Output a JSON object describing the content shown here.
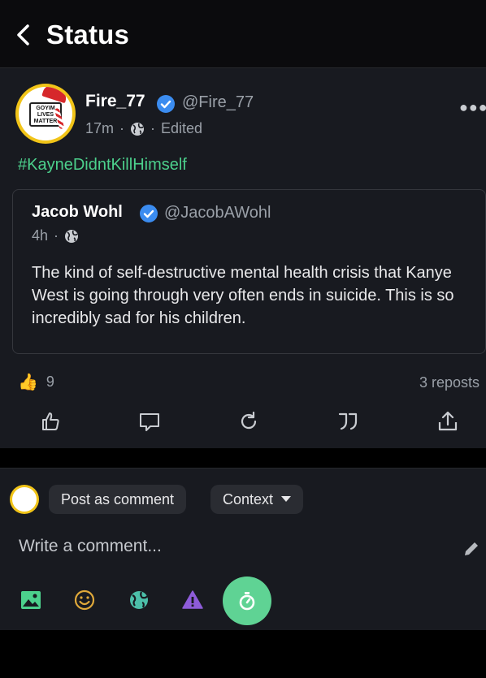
{
  "header": {
    "title": "Status"
  },
  "post": {
    "author_name": "Fire_77",
    "author_handle": "@Fire_77",
    "time": "17m",
    "edited": "Edited",
    "hashtag": "#KayneDidntKillHimself",
    "avatar_text": "GOYIM LIVES MATTER",
    "quote": {
      "author_name": "Jacob Wohl",
      "author_handle": "@JacobAWohl",
      "time": "4h",
      "text": "The kind of self-destructive mental health crisis that Kanye West is going through very often ends in suicide. This is so incredibly sad for his children."
    },
    "like_emoji": "👍",
    "like_count": "9",
    "reposts": "3 reposts"
  },
  "composer": {
    "post_as_label": "Post as comment",
    "context_label": "Context",
    "placeholder": "Write a comment..."
  },
  "icons": {
    "back": "chevron-left-icon",
    "more": "more-icon",
    "verified": "verified-badge-icon",
    "globe": "globe-icon",
    "like": "thumbs-up-icon",
    "reply": "comment-icon",
    "repost": "repost-icon",
    "quote": "quote-icon",
    "share": "share-icon",
    "image": "image-icon",
    "emoji": "emoji-icon",
    "visibility": "globe-icon",
    "warning": "warning-icon",
    "timer": "timer-icon",
    "pencil": "pencil-icon"
  },
  "colors": {
    "accent": "#5fd394",
    "hashtag": "#4cd08c",
    "verified": "#3b8cf0",
    "background": "#181a20",
    "warning": "#8e5cd9",
    "emoji": "#e0a93a"
  }
}
